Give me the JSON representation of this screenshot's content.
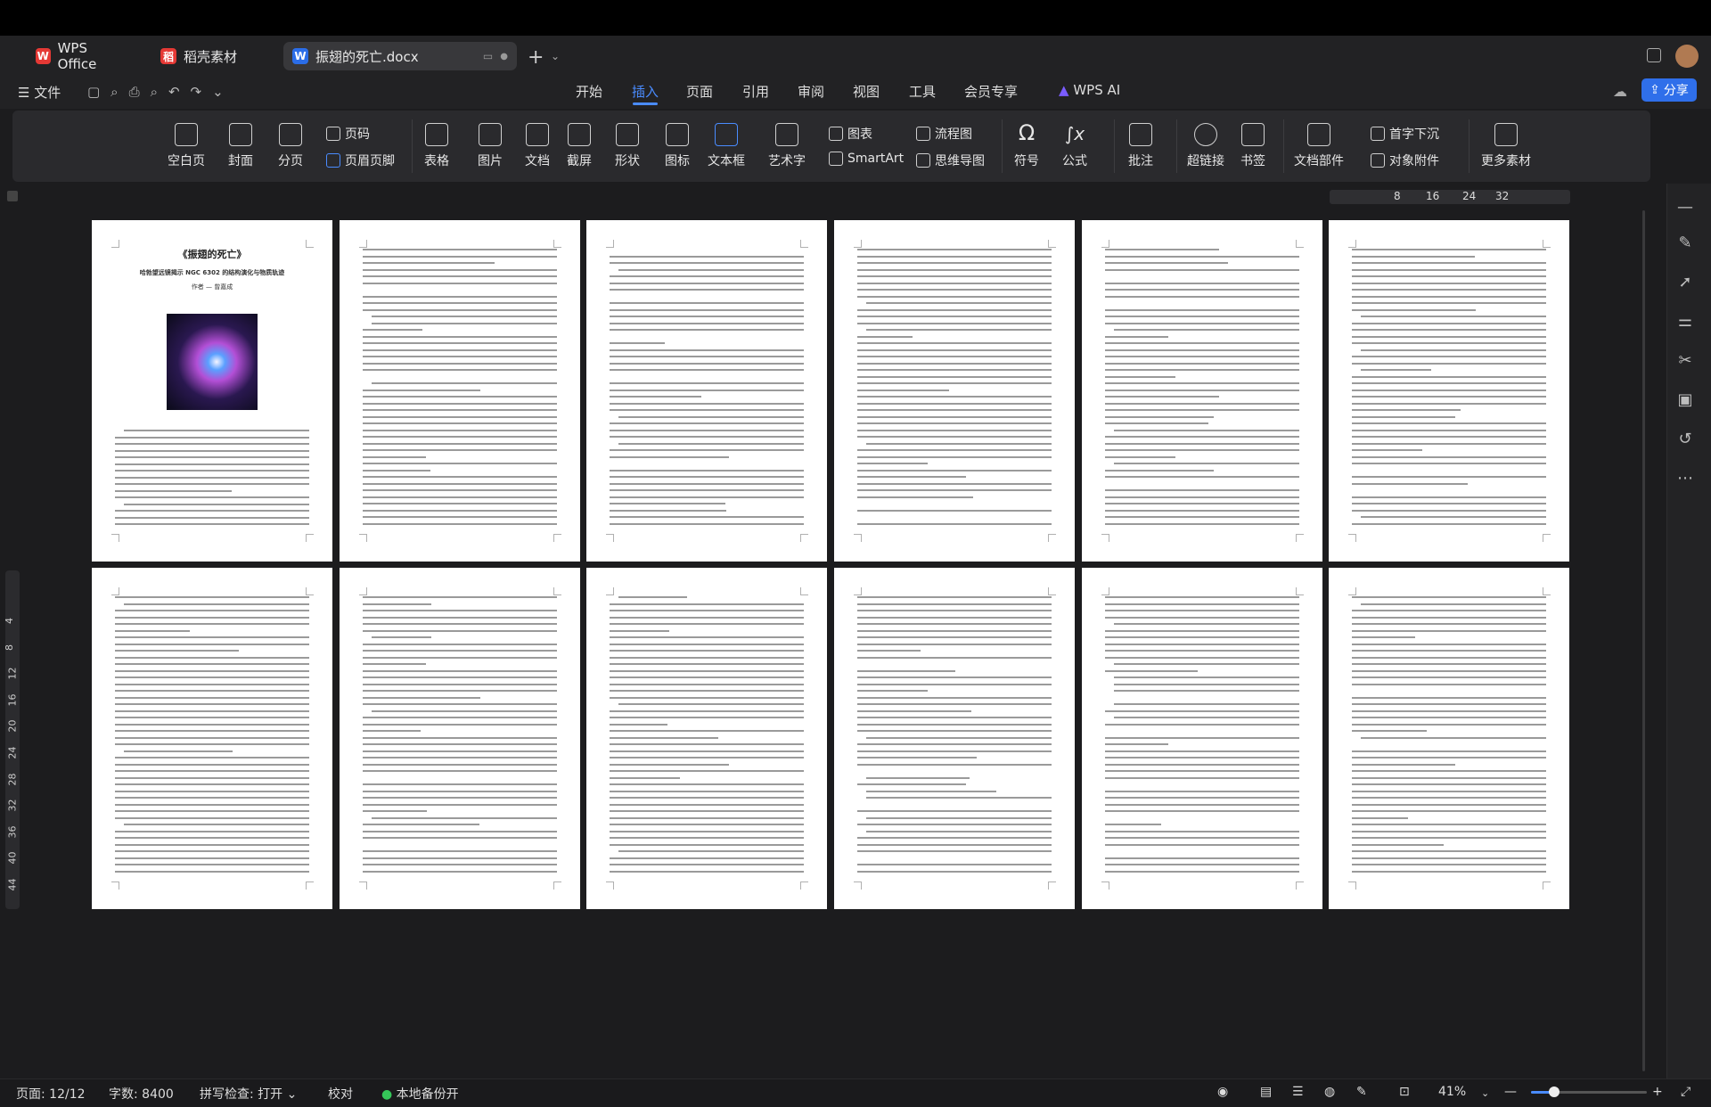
{
  "tabs": [
    {
      "label": "WPS Office",
      "logo": "W",
      "color": "#e53935"
    },
    {
      "label": "稻壳素材",
      "logo": "稻",
      "color": "#e53935"
    },
    {
      "label": "振翅的死亡.docx",
      "logo": "W",
      "color": "#2b6de8"
    }
  ],
  "menu": {
    "file": "文件",
    "items": [
      "开始",
      "插入",
      "页面",
      "引用",
      "审阅",
      "视图",
      "工具",
      "会员专享"
    ],
    "active": "插入",
    "ai": "WPS AI",
    "share": "分享"
  },
  "ribbon": {
    "blank_page": "空白页",
    "cover": "封面",
    "section": "分页",
    "page_number": "页码",
    "header_footer": "页眉页脚",
    "table": "表格",
    "picture": "图片",
    "document": "文档",
    "screenshot": "截屏",
    "shape": "形状",
    "icon": "图标",
    "textbox": "文本框",
    "wordart": "艺术字",
    "chart": "图表",
    "smartart": "SmartArt",
    "flowchart": "流程图",
    "mindmap": "思维导图",
    "symbol": "符号",
    "formula": "公式",
    "comment": "批注",
    "hyperlink": "超链接",
    "bookmark": "书签",
    "doc_parts": "文档部件",
    "dropcap": "首字下沉",
    "object": "对象附件",
    "more": "更多素材"
  },
  "ruler": {
    "ticks": [
      "8",
      "16",
      "24",
      "32"
    ]
  },
  "vruler": {
    "ticks": [
      "4",
      "8",
      "12",
      "16",
      "20",
      "24",
      "28",
      "32",
      "36",
      "40",
      "44"
    ]
  },
  "document": {
    "title": "《振翅的死亡》",
    "subtitle": "哈勃望远镜揭示 NGC 6302 的结构演化与物质轨迹",
    "author": "作者 — 曾嘉成",
    "page_count": 12
  },
  "status": {
    "page": "页面: 12/12",
    "words": "字数: 8400",
    "spell": "拼写检查: 打开",
    "proof": "校对",
    "backup": "本地备份开",
    "zoom": "41%"
  }
}
